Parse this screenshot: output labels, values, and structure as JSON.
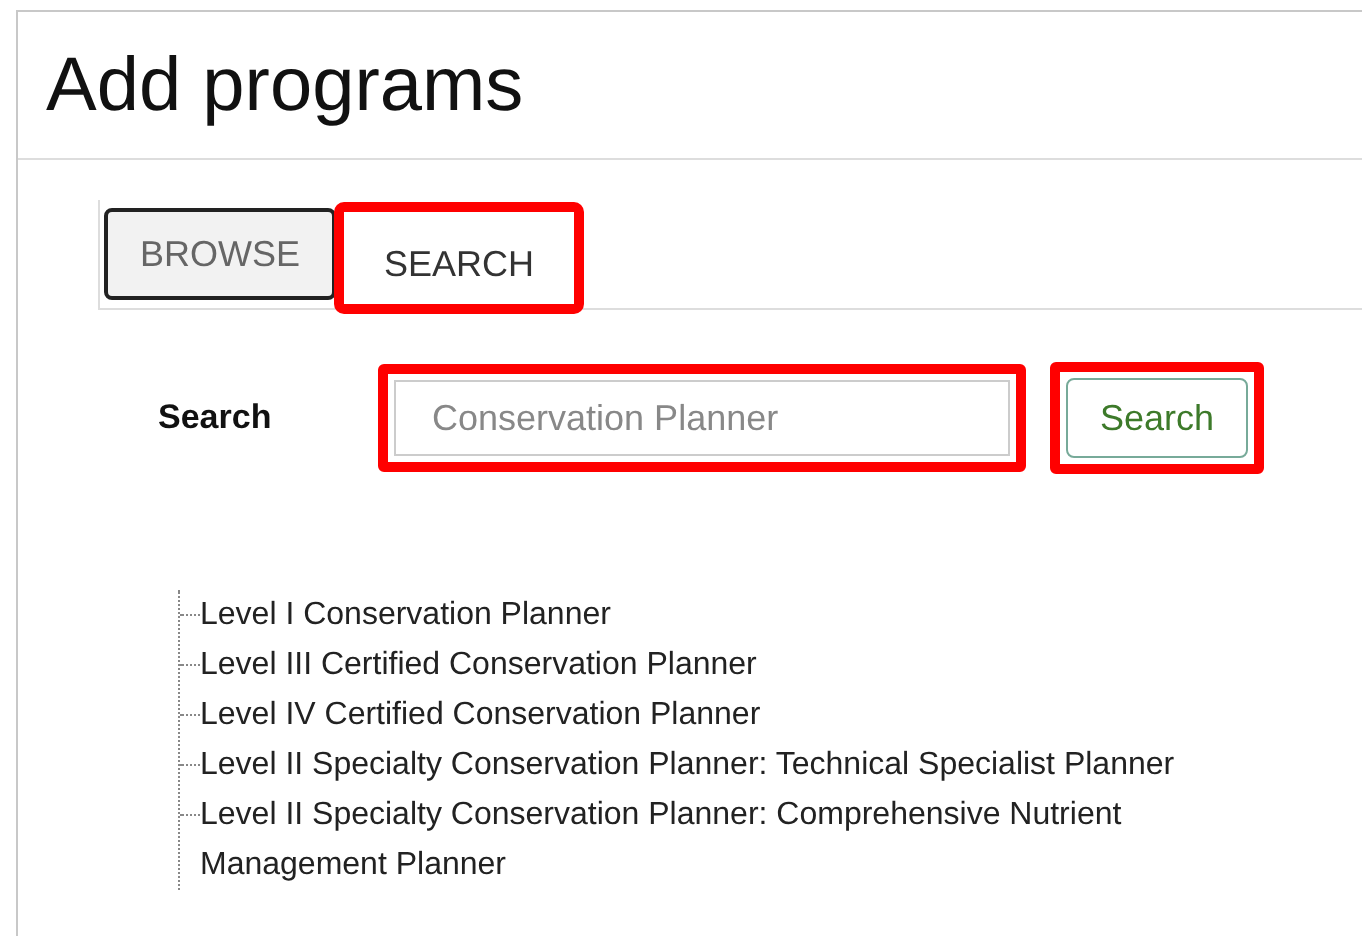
{
  "title": "Add programs",
  "tabs": [
    {
      "label": "BROWSE",
      "selected": false,
      "highlighted": false
    },
    {
      "label": "SEARCH",
      "selected": true,
      "highlighted": true
    }
  ],
  "search": {
    "label": "Search",
    "placeholder": "Conservation Planner",
    "highlighted": true
  },
  "search_button": {
    "label": "Search",
    "highlighted": true
  },
  "results": [
    {
      "label": "Level I Conservation Planner"
    },
    {
      "label": "Level III Certified Conservation Planner"
    },
    {
      "label": "Level IV Certified Conservation Planner"
    },
    {
      "label": "Level II Specialty Conservation Planner: Technical Specialist Planner"
    },
    {
      "label": "Level II Specialty Conservation Planner: Comprehensive Nutrient Management Planner"
    }
  ]
}
